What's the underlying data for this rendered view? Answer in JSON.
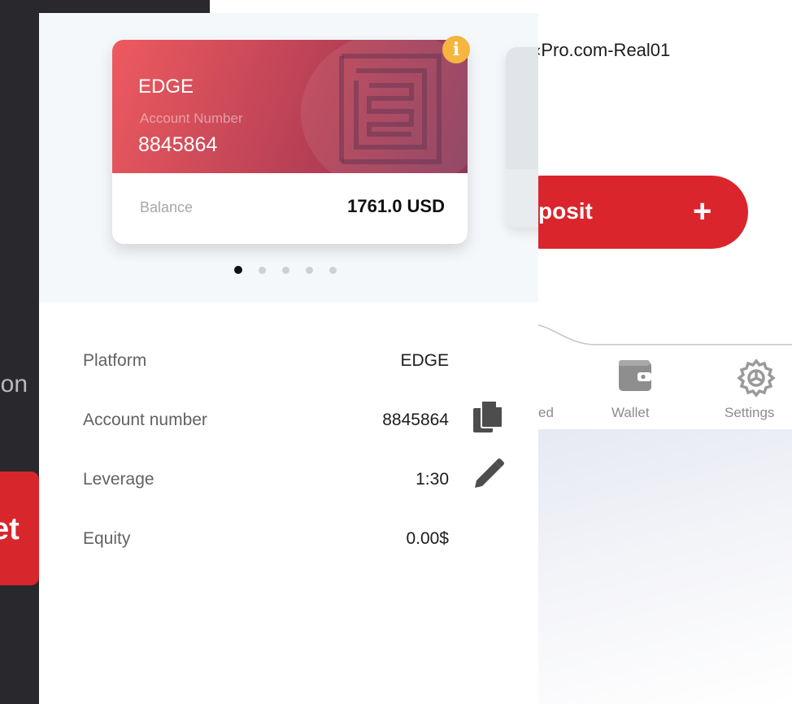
{
  "left_screen": {
    "partial_text": "ion",
    "button_partial_label": "et"
  },
  "card": {
    "platform": "EDGE",
    "account_number_label": "Account Number",
    "account_number": "8845864",
    "balance_label": "Balance",
    "balance_value": "1761.0 USD",
    "info_icon": "info-icon",
    "colors": {
      "gradient_start": "#ee5a5f",
      "gradient_end": "#8a3a5a",
      "badge": "#f5b53f"
    }
  },
  "carousel": {
    "page_count": 5,
    "active_index": 0
  },
  "details": [
    {
      "label": "Platform",
      "value": "EDGE",
      "icon": ""
    },
    {
      "label": "Account number",
      "value": "8845864",
      "icon": "copy-icon"
    },
    {
      "label": "Leverage",
      "value": "1:30",
      "icon": "pencil-icon"
    },
    {
      "label": "Equity",
      "value": "0.00$",
      "icon": ""
    }
  ],
  "right_screen": {
    "account_title": "‹Pro.com-Real01",
    "deposit_label": "posit",
    "deposit_icon": "plus-icon",
    "accent": "#da252c",
    "tabs": [
      {
        "label": "ed",
        "icon": ""
      },
      {
        "label": "Wallet",
        "icon": "wallet-icon"
      },
      {
        "label": "Settings",
        "icon": "gear-icon"
      }
    ]
  }
}
